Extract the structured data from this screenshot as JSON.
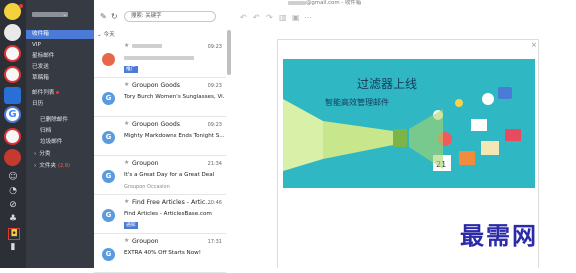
{
  "window": {
    "title_suffix": "@gmail.com - 收件箱"
  },
  "folders": {
    "items": [
      {
        "label": "收件箱",
        "selected": true
      },
      {
        "label": "VIP"
      },
      {
        "label": "星标邮件"
      },
      {
        "label": "已发送"
      },
      {
        "label": "草稿箱"
      },
      {
        "label": "邮件列表",
        "dot": true
      },
      {
        "label": "日历"
      },
      {
        "label": "已删除邮件",
        "sub": true
      },
      {
        "label": "归档",
        "sub": true
      },
      {
        "label": "垃圾邮件",
        "sub": true
      },
      {
        "label": "分类",
        "sub": true,
        "caret": "›"
      },
      {
        "label": "文件夹",
        "sub": true,
        "caret": "›",
        "badge": "(2,9)"
      }
    ]
  },
  "toolbar": {
    "search_placeholder": "搜索: 关键字",
    "section_label": "今天"
  },
  "messages": [
    {
      "sender": "",
      "time": "09:23",
      "subject": "",
      "preview": "",
      "tag": "推广",
      "icon_letter": "",
      "icon_color": "#e8674a",
      "sender_blurred": true
    },
    {
      "sender": "Groupon Goods",
      "time": "09:23",
      "subject": "Tory Burch Women's Sunglasses, Vi...",
      "preview": "",
      "icon_letter": "G",
      "icon_color": "#5a9be0"
    },
    {
      "sender": "Groupon Goods",
      "time": "09:23",
      "subject": "Mighty Markdowns Ends Tonight S...",
      "preview": "",
      "icon_letter": "G",
      "icon_color": "#5a9be0"
    },
    {
      "sender": "Groupon",
      "time": "21:34",
      "subject": "It's a Great Day for a Great Deal",
      "preview": "Groupon Occasion",
      "icon_letter": "G",
      "icon_color": "#5a9be0"
    },
    {
      "sender": "Find Free Articles - Artic...",
      "time": "20:46",
      "subject": "Find Articles - ArticlesBase.com",
      "preview": "",
      "tag": "通知",
      "icon_letter": "G",
      "icon_color": "#5a9be0"
    },
    {
      "sender": "Groupon",
      "time": "17:31",
      "subject": "EXTRA 40% Off Starts Now!",
      "preview": "",
      "icon_letter": "G",
      "icon_color": "#5a9be0"
    }
  ],
  "popup": {
    "title": "过滤器上线",
    "subtitle": "智能高效管理邮件",
    "close": "×"
  },
  "watermark": "最需网",
  "colors": {
    "rail": "#2c2f36",
    "folders": "#363a42",
    "selected": "#4b7bd6",
    "banner": "#2fb8c4",
    "accent_red": "#e23a2f"
  }
}
